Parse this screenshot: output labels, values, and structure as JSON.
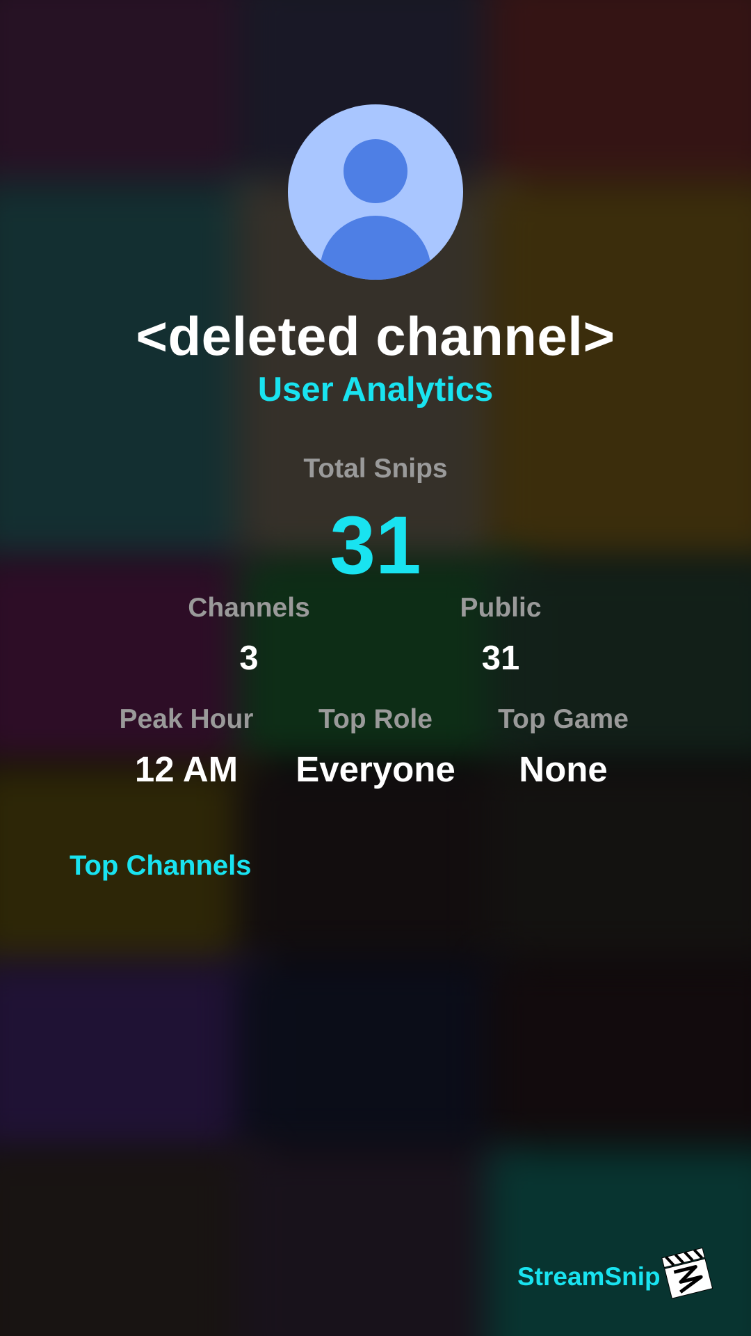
{
  "profile": {
    "channel_name": "<deleted channel>",
    "page_subtitle": "User Analytics",
    "avatar_icon": "default-user-avatar-icon"
  },
  "stats": {
    "total_snips_label": "Total Snips",
    "total_snips_value": "31",
    "channels_label": "Channels",
    "channels_value": "3",
    "public_label": "Public",
    "public_value": "31",
    "peak_hour_label": "Peak Hour",
    "peak_hour_value": "12 AM",
    "top_role_label": "Top Role",
    "top_role_value": "Everyone",
    "top_game_label": "Top Game",
    "top_game_value": "None"
  },
  "sections": {
    "top_channels_label": "Top Channels"
  },
  "brand": {
    "name": "StreamSnip",
    "logo_icon": "clapperboard-logo-icon"
  },
  "colors": {
    "accent": "#19e3f0",
    "text_primary": "#ffffff",
    "text_muted": "#9a9a9a",
    "avatar_bg": "#a9c6ff",
    "avatar_figure": "#4e7fe5"
  }
}
